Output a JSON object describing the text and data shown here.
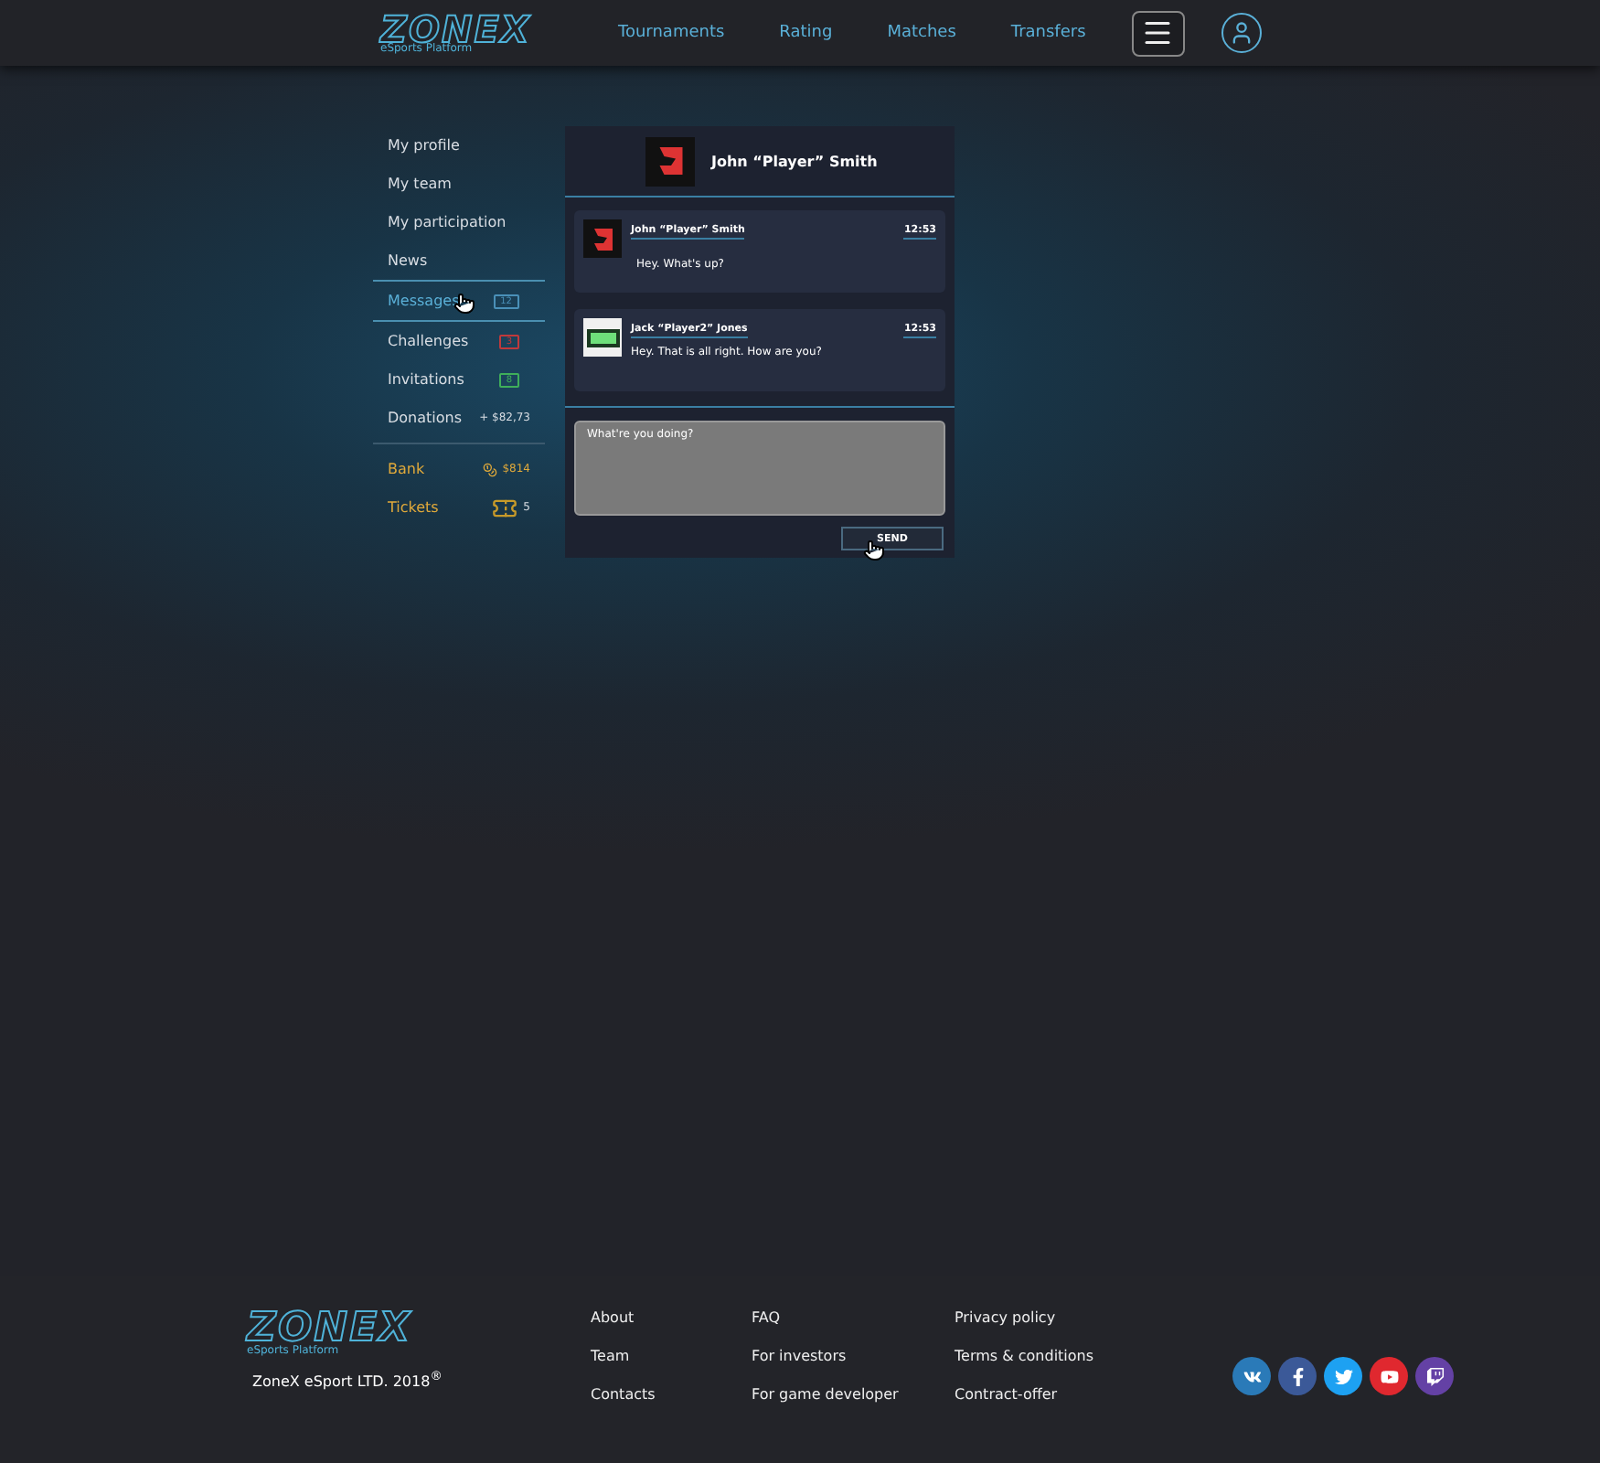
{
  "header": {
    "logo": "ZONEX",
    "logo_tagline": "eSports Platform",
    "nav": [
      "Tournaments",
      "Rating",
      "Matches",
      "Transfers"
    ]
  },
  "sidebar": {
    "items": [
      {
        "kind": "link",
        "label": "My profile",
        "selected": false
      },
      {
        "kind": "link",
        "label": "My team",
        "selected": false
      },
      {
        "kind": "link",
        "label": "My participation",
        "selected": false
      },
      {
        "kind": "link",
        "label": "News",
        "selected": false
      },
      {
        "kind": "badge",
        "label": "Messages",
        "selected": true,
        "count": "12",
        "color": "#4a90b8"
      },
      {
        "kind": "badge",
        "label": "Challenges",
        "selected": false,
        "count": "3",
        "color": "#c0393b"
      },
      {
        "kind": "badge",
        "label": "Invitations",
        "selected": false,
        "count": "8",
        "color": "#3fae5a"
      },
      {
        "kind": "amount",
        "label": "Donations",
        "selected": false,
        "value": "+ $82,73"
      },
      {
        "kind": "coins",
        "label": "Bank",
        "selected": false,
        "value": "$814"
      },
      {
        "kind": "tickets",
        "label": "Tickets",
        "selected": false,
        "value": "5"
      }
    ]
  },
  "chat": {
    "title": "John “Player” Smith",
    "messages": [
      {
        "author": "John “Player” Smith",
        "time": "12:53",
        "text": "Hey. What's up?",
        "kind": "dark"
      },
      {
        "author": "Jack “Player2” Jones",
        "time": "12:53",
        "text": "Hey. That is all right. How are you?",
        "kind": "light"
      }
    ],
    "input": {
      "value": "What're you doing?"
    },
    "send": "SEND"
  },
  "footer": {
    "logo": "ZONEX",
    "logo_tagline": "eSports Platform",
    "copyright": "ZoneX eSport LTD. 2018",
    "mark": "®",
    "columns": [
      [
        "About",
        "Team",
        "Contacts"
      ],
      [
        "FAQ",
        "For investors",
        "For game developer"
      ],
      [
        "Privacy policy",
        "Terms & conditions",
        "Contract-offer"
      ]
    ],
    "social": [
      {
        "kind": "vk",
        "color": "#2a7ab8"
      },
      {
        "kind": "facebook",
        "color": "#3b5998"
      },
      {
        "kind": "twitter",
        "color": "#1da1f2"
      },
      {
        "kind": "youtube",
        "color": "#e0282f"
      },
      {
        "kind": "twitch",
        "color": "#6441a5"
      }
    ]
  }
}
